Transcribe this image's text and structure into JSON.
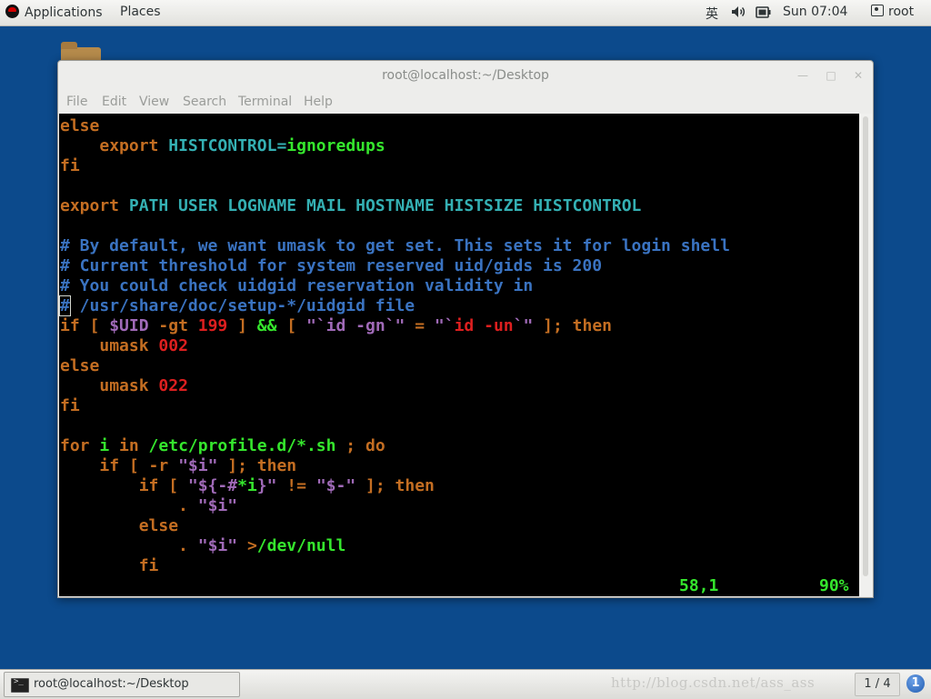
{
  "top_panel": {
    "applications": "Applications",
    "places": "Places",
    "ime": "英",
    "clock": "Sun 07:04",
    "user": "root"
  },
  "window": {
    "title": "root@localhost:~/Desktop",
    "menu": [
      "File",
      "Edit",
      "View",
      "Search",
      "Terminal",
      "Help"
    ]
  },
  "vim": {
    "lines": [
      [
        {
          "t": "else",
          "c": "kw"
        }
      ],
      [
        {
          "t": "    "
        },
        {
          "t": "export",
          "c": "kw"
        },
        {
          "t": " "
        },
        {
          "t": "HISTCONTROL",
          "c": "var"
        },
        {
          "t": "=",
          "c": "var"
        },
        {
          "t": "ignoredups",
          "c": "str"
        }
      ],
      [
        {
          "t": "fi",
          "c": "kw"
        }
      ],
      [
        {
          "t": ""
        }
      ],
      [
        {
          "t": "export",
          "c": "kw"
        },
        {
          "t": " "
        },
        {
          "t": "PATH USER LOGNAME MAIL HOSTNAME HISTSIZE HISTCONTROL",
          "c": "var"
        }
      ],
      [
        {
          "t": ""
        }
      ],
      [
        {
          "t": "# By default, we want umask to get set. This sets it for login shell",
          "c": "cmt"
        }
      ],
      [
        {
          "t": "# Current threshold for system reserved uid/gids is 200",
          "c": "cmt"
        }
      ],
      [
        {
          "t": "# You could check uidgid reservation validity in",
          "c": "cmt"
        }
      ],
      [
        {
          "t": "#",
          "c": "cmt cursor"
        },
        {
          "t": " /usr/share/doc/setup-*/uidgid file",
          "c": "cmt"
        }
      ],
      [
        {
          "t": "if",
          "c": "kw"
        },
        {
          "t": " [ ",
          "c": "op"
        },
        {
          "t": "$UID",
          "c": "sh"
        },
        {
          "t": " -gt ",
          "c": "op"
        },
        {
          "t": "199",
          "c": "num"
        },
        {
          "t": " ] ",
          "c": "op"
        },
        {
          "t": "&&",
          "c": "str"
        },
        {
          "t": " [ ",
          "c": "op"
        },
        {
          "t": "\"`",
          "c": "sh"
        },
        {
          "t": "id -gn",
          "c": "sh"
        },
        {
          "t": "`\"",
          "c": "sh"
        },
        {
          "t": " = ",
          "c": "op"
        },
        {
          "t": "\"`",
          "c": "sh"
        },
        {
          "t": "id -un",
          "c": "num"
        },
        {
          "t": "`\"",
          "c": "sh"
        },
        {
          "t": " ]; ",
          "c": "op"
        },
        {
          "t": "then",
          "c": "kw"
        }
      ],
      [
        {
          "t": "    "
        },
        {
          "t": "umask",
          "c": "kw"
        },
        {
          "t": " "
        },
        {
          "t": "002",
          "c": "num"
        }
      ],
      [
        {
          "t": "else",
          "c": "kw"
        }
      ],
      [
        {
          "t": "    "
        },
        {
          "t": "umask",
          "c": "kw"
        },
        {
          "t": " "
        },
        {
          "t": "022",
          "c": "num"
        }
      ],
      [
        {
          "t": "fi",
          "c": "kw"
        }
      ],
      [
        {
          "t": ""
        }
      ],
      [
        {
          "t": "for",
          "c": "kw"
        },
        {
          "t": " i ",
          "c": "str"
        },
        {
          "t": "in",
          "c": "kw"
        },
        {
          "t": " /etc/profile.d/*.sh ",
          "c": "str"
        },
        {
          "t": ";",
          "c": "op"
        },
        {
          "t": " "
        },
        {
          "t": "do",
          "c": "kw"
        }
      ],
      [
        {
          "t": "    "
        },
        {
          "t": "if",
          "c": "kw"
        },
        {
          "t": " [ -r ",
          "c": "op"
        },
        {
          "t": "\"$i\"",
          "c": "sh"
        },
        {
          "t": " ]; ",
          "c": "op"
        },
        {
          "t": "then",
          "c": "kw"
        }
      ],
      [
        {
          "t": "        "
        },
        {
          "t": "if",
          "c": "kw"
        },
        {
          "t": " [ ",
          "c": "op"
        },
        {
          "t": "\"${-#",
          "c": "sh"
        },
        {
          "t": "*i",
          "c": "str"
        },
        {
          "t": "}\"",
          "c": "sh"
        },
        {
          "t": " != ",
          "c": "op"
        },
        {
          "t": "\"$-\"",
          "c": "sh"
        },
        {
          "t": " ]; ",
          "c": "op"
        },
        {
          "t": "then",
          "c": "kw"
        }
      ],
      [
        {
          "t": "            "
        },
        {
          "t": ".",
          "c": "kw"
        },
        {
          "t": " "
        },
        {
          "t": "\"$i\"",
          "c": "sh"
        }
      ],
      [
        {
          "t": "        "
        },
        {
          "t": "else",
          "c": "kw"
        }
      ],
      [
        {
          "t": "            "
        },
        {
          "t": ".",
          "c": "kw"
        },
        {
          "t": " "
        },
        {
          "t": "\"$i\"",
          "c": "sh"
        },
        {
          "t": " "
        },
        {
          "t": ">",
          "c": "op"
        },
        {
          "t": "/dev/null",
          "c": "str"
        }
      ],
      [
        {
          "t": "        "
        },
        {
          "t": "fi",
          "c": "kw"
        }
      ]
    ],
    "cursor_position": "58,1",
    "scroll_percent": "90%"
  },
  "taskbar": {
    "window_label": "root@localhost:~/Desktop",
    "watermark": "http://blog.csdn.net/ass_ass",
    "workspace": "1 / 4",
    "notification": "1"
  }
}
